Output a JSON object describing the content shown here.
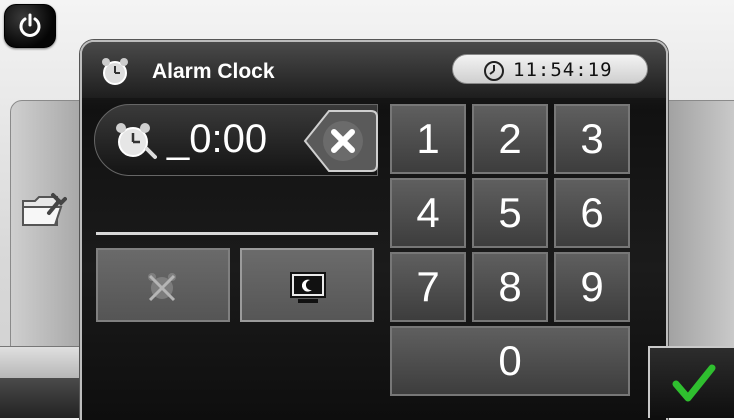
{
  "title": "Alarm Clock",
  "clock": {
    "time": "11:54:19"
  },
  "alarm": {
    "value": "_0:00"
  },
  "keypad": {
    "keys": [
      "1",
      "2",
      "3",
      "4",
      "5",
      "6",
      "7",
      "8",
      "9",
      "0"
    ]
  },
  "icons": {
    "power": "power-icon",
    "settings": "folder-wrench-icon",
    "alarm": "alarm-clock-icon",
    "clear": "close-icon",
    "alarm_off": "alarm-off-icon",
    "sleep": "sleep-mode-icon",
    "confirm": "checkmark-icon"
  },
  "colors": {
    "confirm": "#2fbf2f",
    "background": "#111111"
  }
}
